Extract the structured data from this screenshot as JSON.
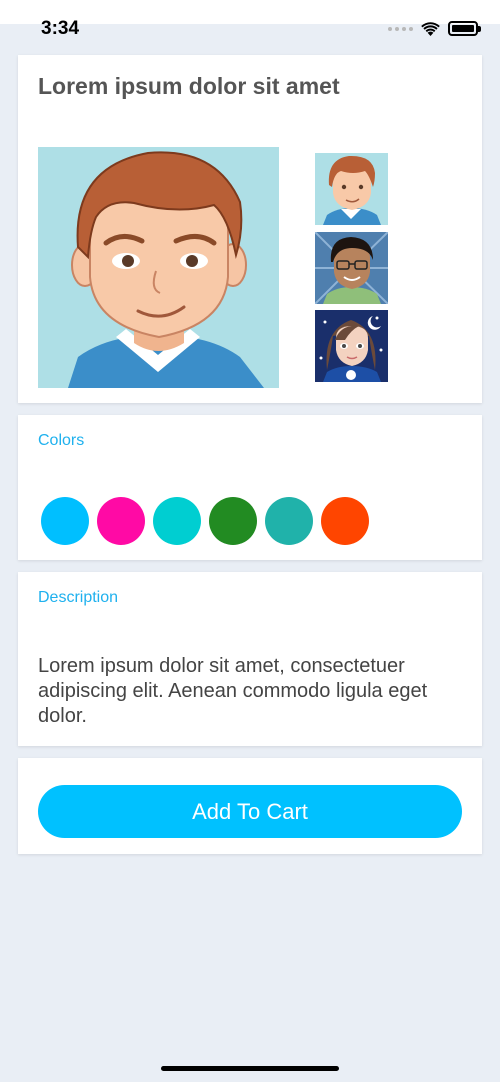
{
  "status_bar": {
    "time": "3:34"
  },
  "product": {
    "title": "Lorem ipsum dolor sit amet",
    "main_image": "man-avatar",
    "thumbnails": [
      "man-avatar",
      "man-glasses-avatar",
      "woman-avatar"
    ]
  },
  "colors_section": {
    "label": "Colors",
    "swatches": [
      "#00bfff",
      "#ff0aa5",
      "#00ced1",
      "#228b22",
      "#20b2aa",
      "#ff4500"
    ]
  },
  "description_section": {
    "label": "Description",
    "text": "Lorem ipsum dolor sit amet, consectetuer adipiscing elit. Aenean commodo ligula eget dolor."
  },
  "cart": {
    "button_label": "Add To Cart",
    "button_color": "#00c1ff"
  }
}
